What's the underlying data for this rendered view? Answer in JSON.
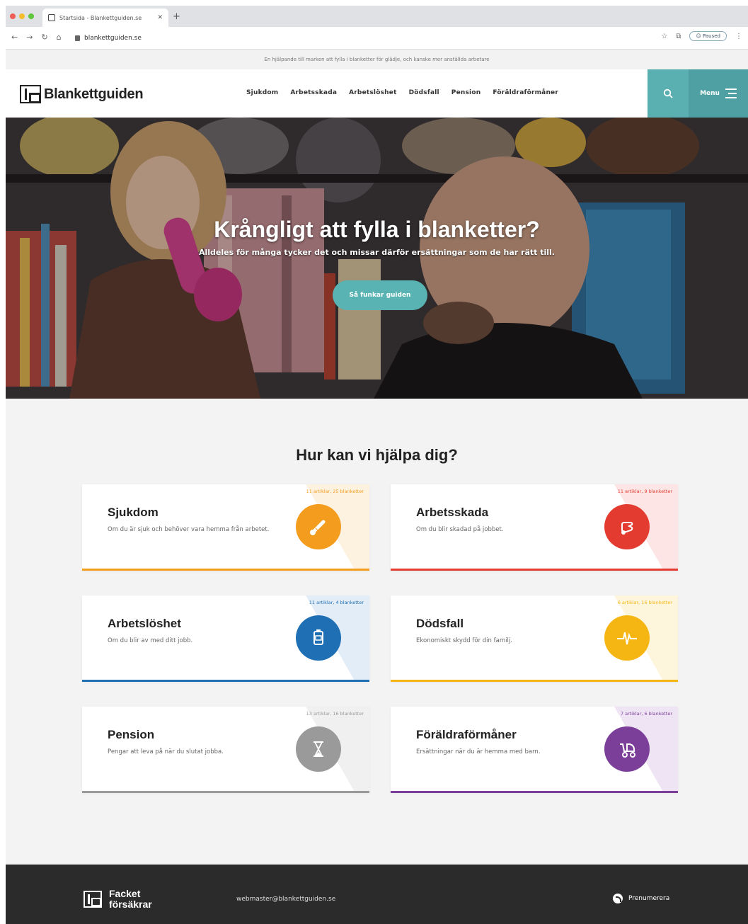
{
  "browser": {
    "tab_title": "Startsida - Blankettguiden.se",
    "url": "blankettguiden.se",
    "profile_label": "Paused"
  },
  "notice": "En hjälpande till marken att fylla i blanketter för glädje, och kanske mer anställda arbetare",
  "site": {
    "logo_text": "Blankettguiden",
    "nav": [
      "Sjukdom",
      "Arbetsskada",
      "Arbetslöshet",
      "Dödsfall",
      "Pension",
      "Föräldraförmåner"
    ],
    "menu_label": "Menu"
  },
  "hero": {
    "title": "Krångligt att fylla i blanketter?",
    "subtitle": "Alldeles för många tycker det och missar därför ersättningar som de har rätt till.",
    "button": "Så funkar guiden"
  },
  "help": {
    "title": "Hur kan vi hjälpa dig?",
    "cards": [
      {
        "title": "Sjukdom",
        "desc": "Om du är sjuk och behöver vara hemma från arbetet.",
        "meta": "11 artiklar, 25 blanketter",
        "color": "#f39c1e",
        "icon": "thermometer-icon"
      },
      {
        "title": "Arbetsskada",
        "desc": "Om du blir skadad på jobbet.",
        "meta": "11 artiklar, 9 blanketter",
        "color": "#e33b30",
        "icon": "injured-hand-icon"
      },
      {
        "title": "Arbetslöshet",
        "desc": "Om du blir av med ditt jobb.",
        "meta": "11 artiklar, 4 blanketter",
        "color": "#1f6fb5",
        "icon": "coffee-cup-icon"
      },
      {
        "title": "Dödsfall",
        "desc": "Ekonomiskt skydd för din familj.",
        "meta": "6 artiklar, 16 blanketter",
        "color": "#f5b613",
        "icon": "heartbeat-icon"
      },
      {
        "title": "Pension",
        "desc": "Pengar att leva på när du slutat jobba.",
        "meta": "13 artiklar, 16 blanketter",
        "color": "#9a9a9a",
        "icon": "hourglass-icon"
      },
      {
        "title": "Föräldraförmåner",
        "desc": "Ersättningar när du är hemma med barn.",
        "meta": "7 artiklar, 6 blanketter",
        "color": "#7b3f99",
        "icon": "stroller-icon"
      }
    ]
  },
  "footer": {
    "logo_line1": "Facket",
    "logo_line2": "försäkrar",
    "email": "webmaster@blankettguiden.se",
    "subscribe": "Prenumerera"
  }
}
